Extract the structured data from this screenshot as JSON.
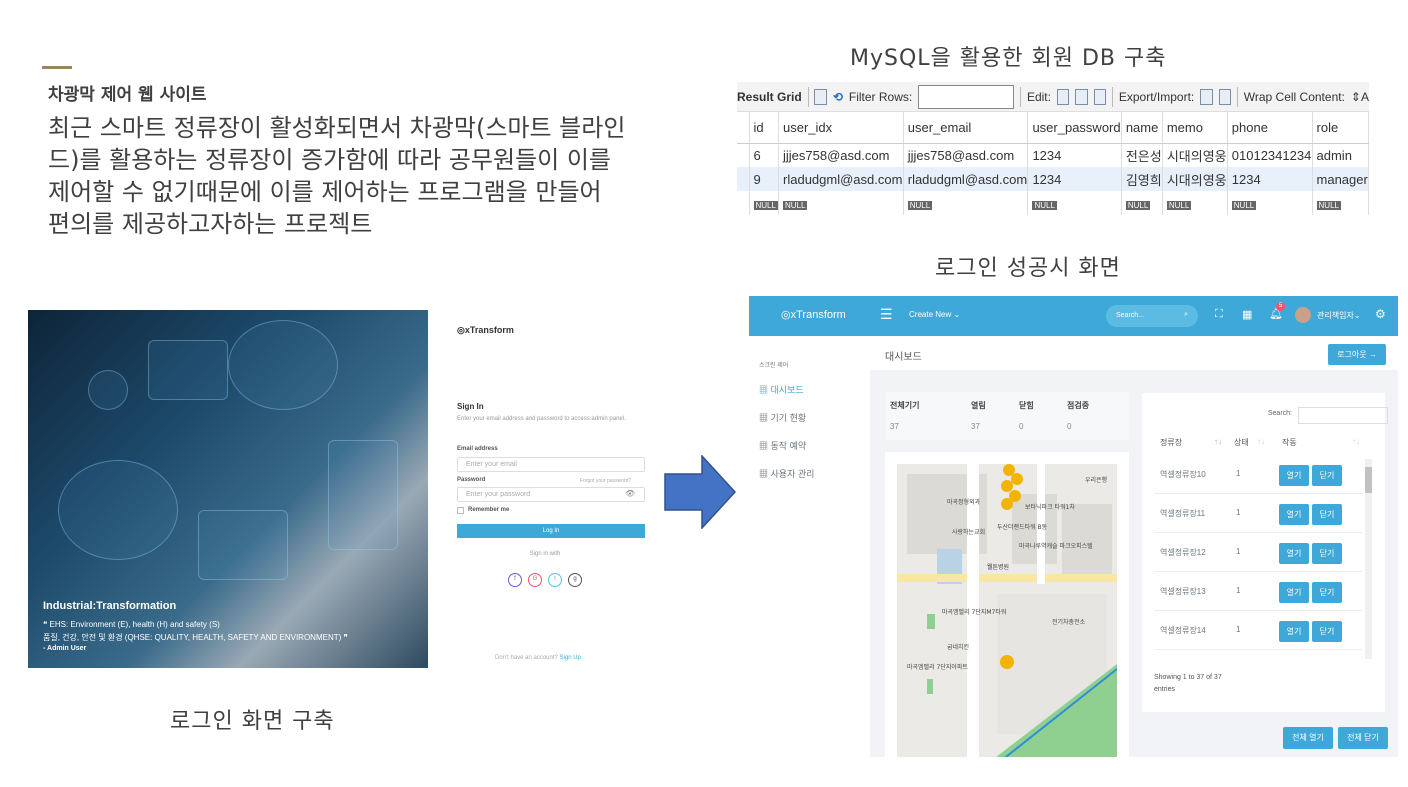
{
  "slide": {
    "subtitle": "차광막 제어 웹 사이트",
    "description": "최근 스마트 정류장이 활성화되면서 차광막(스마트 블라인드)를 활용하는 정류장이 증가함에 따라 공무원들이 이를 제어할 수 없기때문에 이를 제어하는 프로그램을 만들어 편의를 제공하고자하는 프로젝트",
    "db_caption": "MySQL을 활용한 회원 DB 구축",
    "success_caption": "로그인 성공시 화면",
    "login_caption": "로그인 화면 구축",
    "accent_color": "#9c8461",
    "arrow_color": "#4472c4"
  },
  "grid": {
    "result_grid": "Result Grid",
    "filter_rows": "Filter Rows:",
    "edit": "Edit:",
    "export_import": "Export/Import:",
    "wrap": "Wrap Cell Content:",
    "columns": [
      "id",
      "user_idx",
      "user_email",
      "user_password",
      "name",
      "memo",
      "phone",
      "role"
    ],
    "rows": [
      [
        "6",
        "jjjes758@asd.com",
        "jjjes758@asd.com",
        "1234",
        "전은성",
        "시대의영웅",
        "01012341234",
        "admin"
      ],
      [
        "9",
        "rladudgml@asd.com",
        "rladudgml@asd.com",
        "1234",
        "김영희",
        "시대의영웅",
        "1234",
        "manager"
      ]
    ],
    "null": "NULL"
  },
  "login": {
    "hero_title": "Industrial:Transformation",
    "quote_line1": "❝ EHS: Environment (E), health (H) and safety (S)",
    "quote_line2": "품질, 건강, 안전 및 환경 (QHSE: QUALITY, HEALTH, SAFETY AND ENVIRONMENT) ❞",
    "author": "- Admin User",
    "brand": "xTransform",
    "sign_in": "Sign In",
    "intro": "Enter your email address and password to access admin panel.",
    "email_label": "Email address",
    "email_placeholder": "Enter your email",
    "password_label": "Password",
    "forgot": "Forgot your password?",
    "password_placeholder": "Enter your password",
    "remember": "Remember me",
    "login_button": "Log In",
    "sign_in_with": "Sign in with",
    "no_account": "Don't have an account?",
    "sign_up": "Sign Up"
  },
  "dashboard": {
    "brand": "xTransform",
    "create_new": "Create New ⌄",
    "search_placeholder": "Search...",
    "notif_count": "5",
    "user": "관리책임자⌄",
    "header_color": "#3ea9d8",
    "sidebar": {
      "section": "스크린 제어",
      "items": [
        "대시보드",
        "기기 현황",
        "동작 예약",
        "사용자 관리"
      ]
    },
    "page_title": "대시보드",
    "logout": "로그아웃 →",
    "stats": {
      "headers": [
        "전체기기",
        "열림",
        "닫힘",
        "점검중"
      ],
      "values": [
        "37",
        "37",
        "0",
        "0"
      ]
    },
    "map_labels": [
      "마곡정형외과",
      "사랑하는교회",
      "보타닉파크 타워1차",
      "두산더랜드타워 B동",
      "마곡나루역캐슬 파크오피스텔",
      "웰튼병원",
      "마곡엠벨리 7단지M7타워",
      "전기차충전소",
      "굽네치킨",
      "마곡엠벨리 7단지아파트",
      "우리은행"
    ],
    "table": {
      "search_label": "Search:",
      "headers": [
        "정류장",
        "상태",
        "작동"
      ],
      "rows": [
        {
          "name": "역셀정류장10",
          "state": "1"
        },
        {
          "name": "역셀정류장11",
          "state": "1"
        },
        {
          "name": "역셀정류장12",
          "state": "1"
        },
        {
          "name": "역셀정류장13",
          "state": "1"
        },
        {
          "name": "역셀정류장14",
          "state": "1"
        }
      ],
      "open": "열기",
      "close": "닫기",
      "info": "Showing 1 to 37 of 37 entries"
    },
    "open_all": "전체 열기",
    "close_all": "전체 닫기"
  }
}
